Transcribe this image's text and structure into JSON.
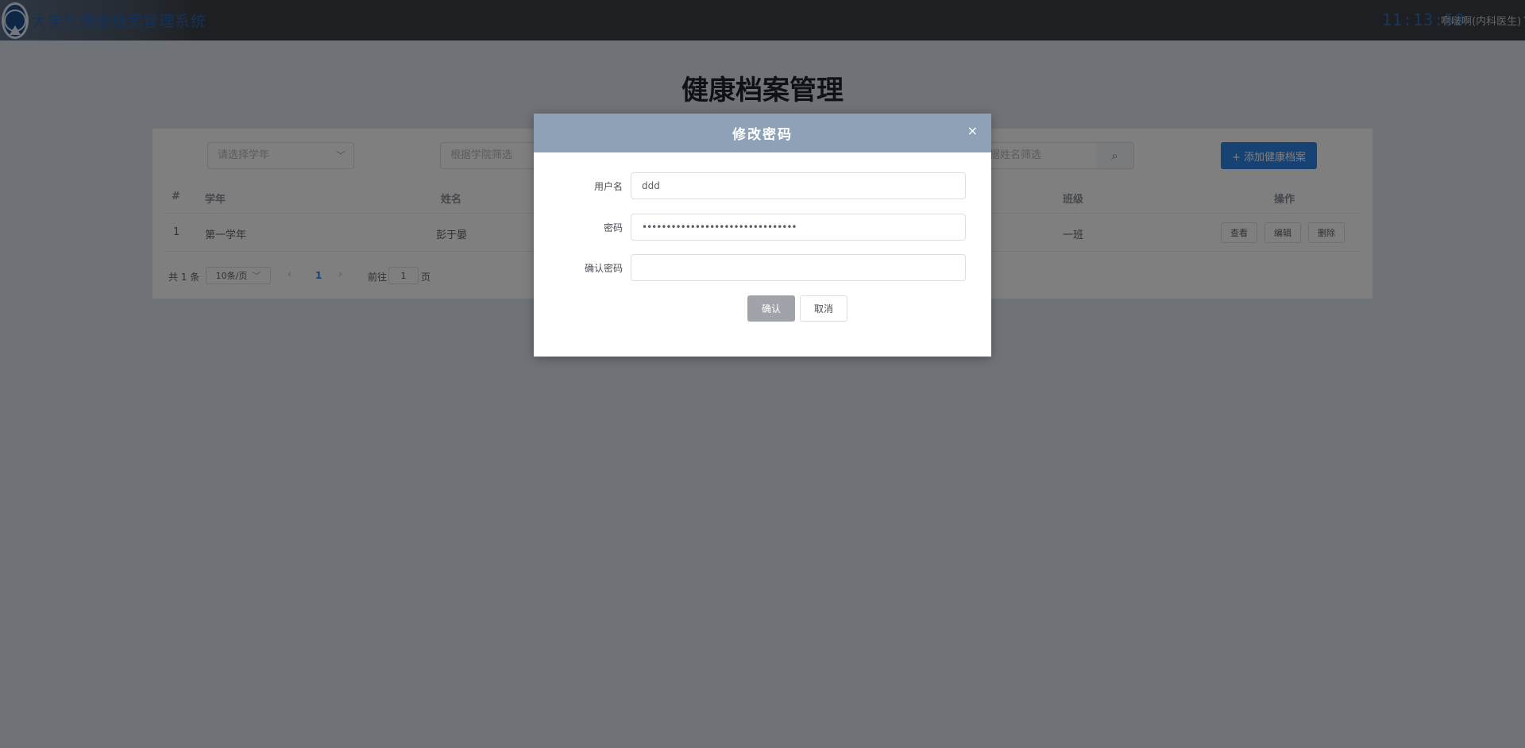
{
  "header": {
    "app_title": "大学生健康档案管理系统",
    "clock": "11:13:50",
    "user": "啊啵啊(内科医生)"
  },
  "page": {
    "title": "健康档案管理"
  },
  "filters": {
    "year_placeholder": "请选择学年",
    "college_placeholder": "根据学院筛选",
    "name_placeholder": "根据姓名筛选",
    "add_button": "+ 添加健康档案"
  },
  "table": {
    "headers": {
      "index": "#",
      "year": "学年",
      "name": "姓名",
      "class": "班级",
      "ops": "操作"
    },
    "rows": [
      {
        "index": "1",
        "year": "第一学年",
        "name": "彭于晏",
        "class": "一班"
      }
    ],
    "ops": {
      "view": "查看",
      "edit": "编辑",
      "delete": "删除"
    }
  },
  "pagination": {
    "total": "共 1 条",
    "page_size": "10条/页",
    "prev": "‹",
    "current": "1",
    "next": "›",
    "goto_prefix": "前往",
    "goto_value": "1",
    "goto_suffix": "页"
  },
  "dialog": {
    "title": "修改密码",
    "close": "×",
    "username_label": "用户名",
    "username_value": "ddd",
    "password_label": "密码",
    "password_value": "••••••••••••••••••••••••••••••••",
    "confirm_label": "确认密码",
    "confirm_value": "",
    "ok": "确认",
    "cancel": "取消"
  }
}
